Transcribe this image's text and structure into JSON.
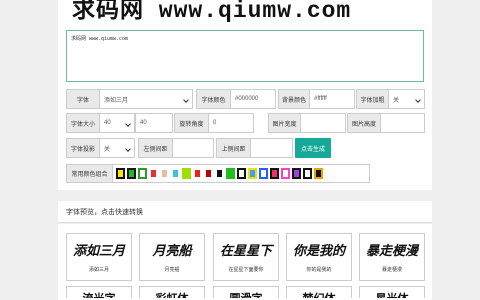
{
  "banner": {
    "text": "求码网 www.qiumw.com"
  },
  "editor": {
    "text": "求码网 www.qiumw.com"
  },
  "row1": {
    "font_label": "字体",
    "font_value": "添如三月",
    "font_color_label": "字体颜色",
    "font_color_value": "#000000",
    "bg_color_label": "背景颜色",
    "bg_color_value": "#ffffff",
    "bold_label": "字体加粗",
    "bold_value": "关"
  },
  "row2": {
    "size_label": "字体大小",
    "size_select": "40",
    "size_value": "40",
    "rotate_label": "旋转角度",
    "rotate_value": "0",
    "width_label": "图片宽度",
    "width_value": "",
    "height_label": "图片高度",
    "height_value": ""
  },
  "row3": {
    "shadow_label": "字体投影",
    "shadow_value": "关",
    "lr_spacing_label": "左侧间距",
    "lr_spacing_value": "",
    "tb_spacing_label": "上侧间距",
    "tb_spacing_value": "",
    "generate_label": "点击生成"
  },
  "row4": {
    "combo_label": "常用颜色组合",
    "swatches": [
      {
        "outer": "#111111",
        "inner": "#f4e800"
      },
      {
        "outer": "#1a1a1a",
        "inner": "#2bb52b"
      },
      {
        "outer": "#2a9a2a",
        "inner": "#ffffff"
      },
      {
        "outer": "#ffffff",
        "inner": "#e83030"
      },
      {
        "outer": "#ffffff",
        "inner": "#e0c0a0"
      },
      {
        "outer": "#ffffff",
        "inner": "#40c0e0"
      },
      {
        "outer": "#9ee000",
        "inner": "#9ee000"
      },
      {
        "outer": "#ffffff",
        "inner": "#e82020"
      },
      {
        "outer": "#ffffff",
        "inner": "#c00000"
      },
      {
        "outer": "#ffffff",
        "inner": "#111111"
      },
      {
        "outer": "#20c020",
        "inner": "#20c020"
      },
      {
        "outer": "#111111",
        "inner": "#ffffff"
      },
      {
        "outer": "#f0e000",
        "inner": "#40a0ff"
      },
      {
        "outer": "#2060ff",
        "inner": "#ffffff"
      },
      {
        "outer": "#111111",
        "inner": "#f03060"
      },
      {
        "outer": "#ff40c0",
        "inner": "#ffffff"
      },
      {
        "outer": "#111111",
        "inner": "#a040e0"
      },
      {
        "outer": "#111111",
        "inner": "#ffffff"
      },
      {
        "outer": "#f0a000",
        "inner": "#111111"
      }
    ]
  },
  "preview": {
    "title": "字体预览，点击快速转换",
    "cards": [
      {
        "art": "添如三月",
        "name": "添如三月"
      },
      {
        "art": "月亮船",
        "name": "月亮船"
      },
      {
        "art": "在星星下",
        "name": "在星星下面要你"
      },
      {
        "art": "你是我的",
        "name": "你的是我的"
      },
      {
        "art": "暴走梗漫",
        "name": "暴走梗漫"
      }
    ],
    "row2_art": [
      "流光字",
      "彩虹体",
      "圆滑字",
      "梦幻体",
      "星光体"
    ]
  }
}
